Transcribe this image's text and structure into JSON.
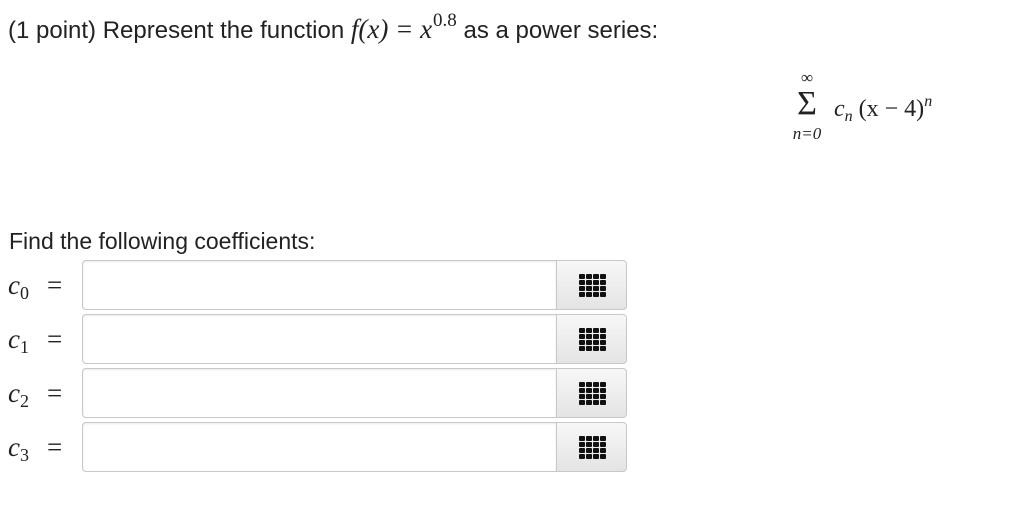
{
  "problem": {
    "prefix": "(1 point) Represent the function ",
    "function_lhs": "f(x) = x",
    "function_exponent": "0.8",
    "suffix": " as a power series:"
  },
  "series": {
    "sigma": "Σ",
    "upper_limit": "∞",
    "lower_limit": "n=0",
    "coefficient": "c",
    "coefficient_subscript": "n",
    "base": "(x − 4)",
    "exponent": "n"
  },
  "instructions": "Find the following coefficients:",
  "coefficients": [
    {
      "letter": "c",
      "index": "0",
      "equals": "=",
      "value": "",
      "placeholder": ""
    },
    {
      "letter": "c",
      "index": "1",
      "equals": "=",
      "value": "",
      "placeholder": ""
    },
    {
      "letter": "c",
      "index": "2",
      "equals": "=",
      "value": "",
      "placeholder": ""
    },
    {
      "letter": "c",
      "index": "3",
      "equals": "=",
      "value": "",
      "placeholder": ""
    }
  ],
  "icons": {
    "palette_button_icon": "equation-editor-grid-icon"
  }
}
